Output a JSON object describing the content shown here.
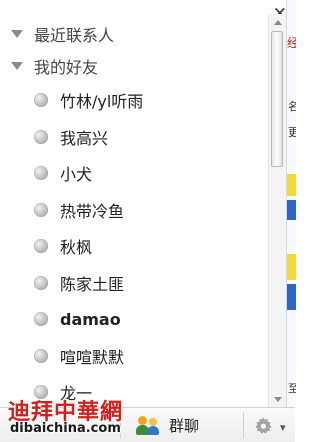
{
  "window": {
    "close_glyph": "✕"
  },
  "contacts": {
    "groups": [
      {
        "label": "最近联系人",
        "expanded": false
      },
      {
        "label": "我的好友",
        "expanded": true
      }
    ],
    "friends": [
      {
        "name": "竹林/yl听雨",
        "bold": false
      },
      {
        "name": "我高兴",
        "bold": false
      },
      {
        "name": "小犬",
        "bold": false
      },
      {
        "name": "热带冷鱼",
        "bold": false
      },
      {
        "name": "秋枫",
        "bold": false
      },
      {
        "name": "陈家土匪",
        "bold": false
      },
      {
        "name": "damao",
        "bold": true
      },
      {
        "name": "喧喧默默",
        "bold": false
      },
      {
        "name": "龙一",
        "bold": false
      }
    ],
    "status_dot_color": "#b9b9b9"
  },
  "bottom_bar": {
    "group_chat_label": "群聊",
    "group_chat_icon": "people-icon",
    "settings_icon": "gear-icon",
    "dropdown_icon": "caret-down-icon"
  },
  "right_strip": {
    "red_text": "经",
    "text_a": "名",
    "text_b": "更",
    "text_c": "至"
  },
  "watermark": {
    "title": "迪拜中華網",
    "url": "dibaichina.com"
  },
  "colors": {
    "watermark_red": "#d2201c",
    "accent_yellow": "#f4d93b",
    "accent_blue": "#2c66c7"
  }
}
